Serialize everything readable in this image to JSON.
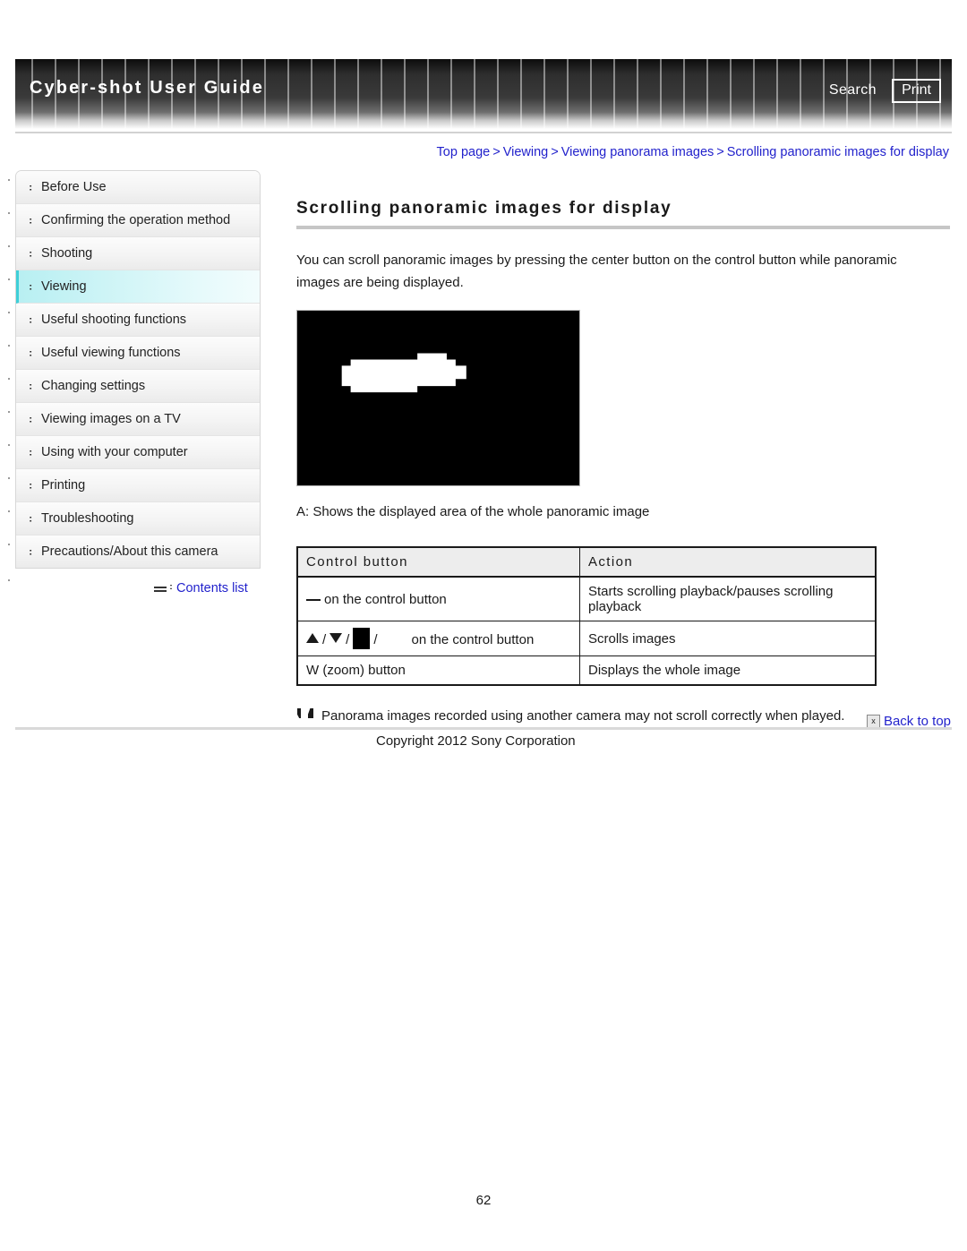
{
  "header": {
    "guide_title": "Cyber-shot User Guide",
    "search_label": "Search",
    "print_label": "Print"
  },
  "breadcrumb": {
    "separator": ">",
    "items": [
      {
        "label": "Top page"
      },
      {
        "label": "Viewing"
      },
      {
        "label": "Viewing panorama images"
      },
      {
        "label": "Scrolling panoramic images for display"
      }
    ]
  },
  "sidebar": {
    "bullet": ":",
    "items": [
      {
        "label": "Before Use",
        "active": false
      },
      {
        "label": "Confirming the operation method",
        "active": false
      },
      {
        "label": "Shooting",
        "active": false
      },
      {
        "label": "Viewing",
        "active": true
      },
      {
        "label": "Useful shooting functions",
        "active": false
      },
      {
        "label": "Useful viewing functions",
        "active": false
      },
      {
        "label": "Changing settings",
        "active": false
      },
      {
        "label": "Viewing images on a TV",
        "active": false
      },
      {
        "label": "Using with your computer",
        "active": false
      },
      {
        "label": "Printing",
        "active": false
      },
      {
        "label": "Troubleshooting",
        "active": false
      },
      {
        "label": "Precautions/About this camera",
        "active": false
      }
    ],
    "contents_list_label": "Contents list"
  },
  "main": {
    "title": "Scrolling panoramic images for display",
    "intro": "You can scroll panoramic images by pressing the center button on the control button while panoramic images are being displayed.",
    "figure_caption": "A: Shows the displayed area of the whole panoramic image",
    "table": {
      "headers": [
        "Control button",
        "Action"
      ],
      "rows": [
        {
          "control_glyph": "underscore",
          "control_text": "on the control button",
          "action": "Starts scrolling playback/pauses scrolling playback"
        },
        {
          "control_glyph": "arrows",
          "control_text": "on the control button",
          "action": "Scrolls images"
        },
        {
          "control_glyph": "none",
          "control_text": "W (zoom) button",
          "action": "Displays the whole image"
        }
      ]
    },
    "note": "Panorama images recorded using another camera may not scroll correctly when played.",
    "back_to_top_label": "Back to top",
    "broken_icon_glyph": "x"
  },
  "footer": {
    "copyright": "Copyright 2012 Sony Corporation",
    "page_number": "62"
  },
  "colors": {
    "link": "#2222cc",
    "active_nav": "#b8eff2",
    "header_dark": "#1a1a1a",
    "figure_bg": "#000000",
    "figure_shape": "#ffffff"
  }
}
